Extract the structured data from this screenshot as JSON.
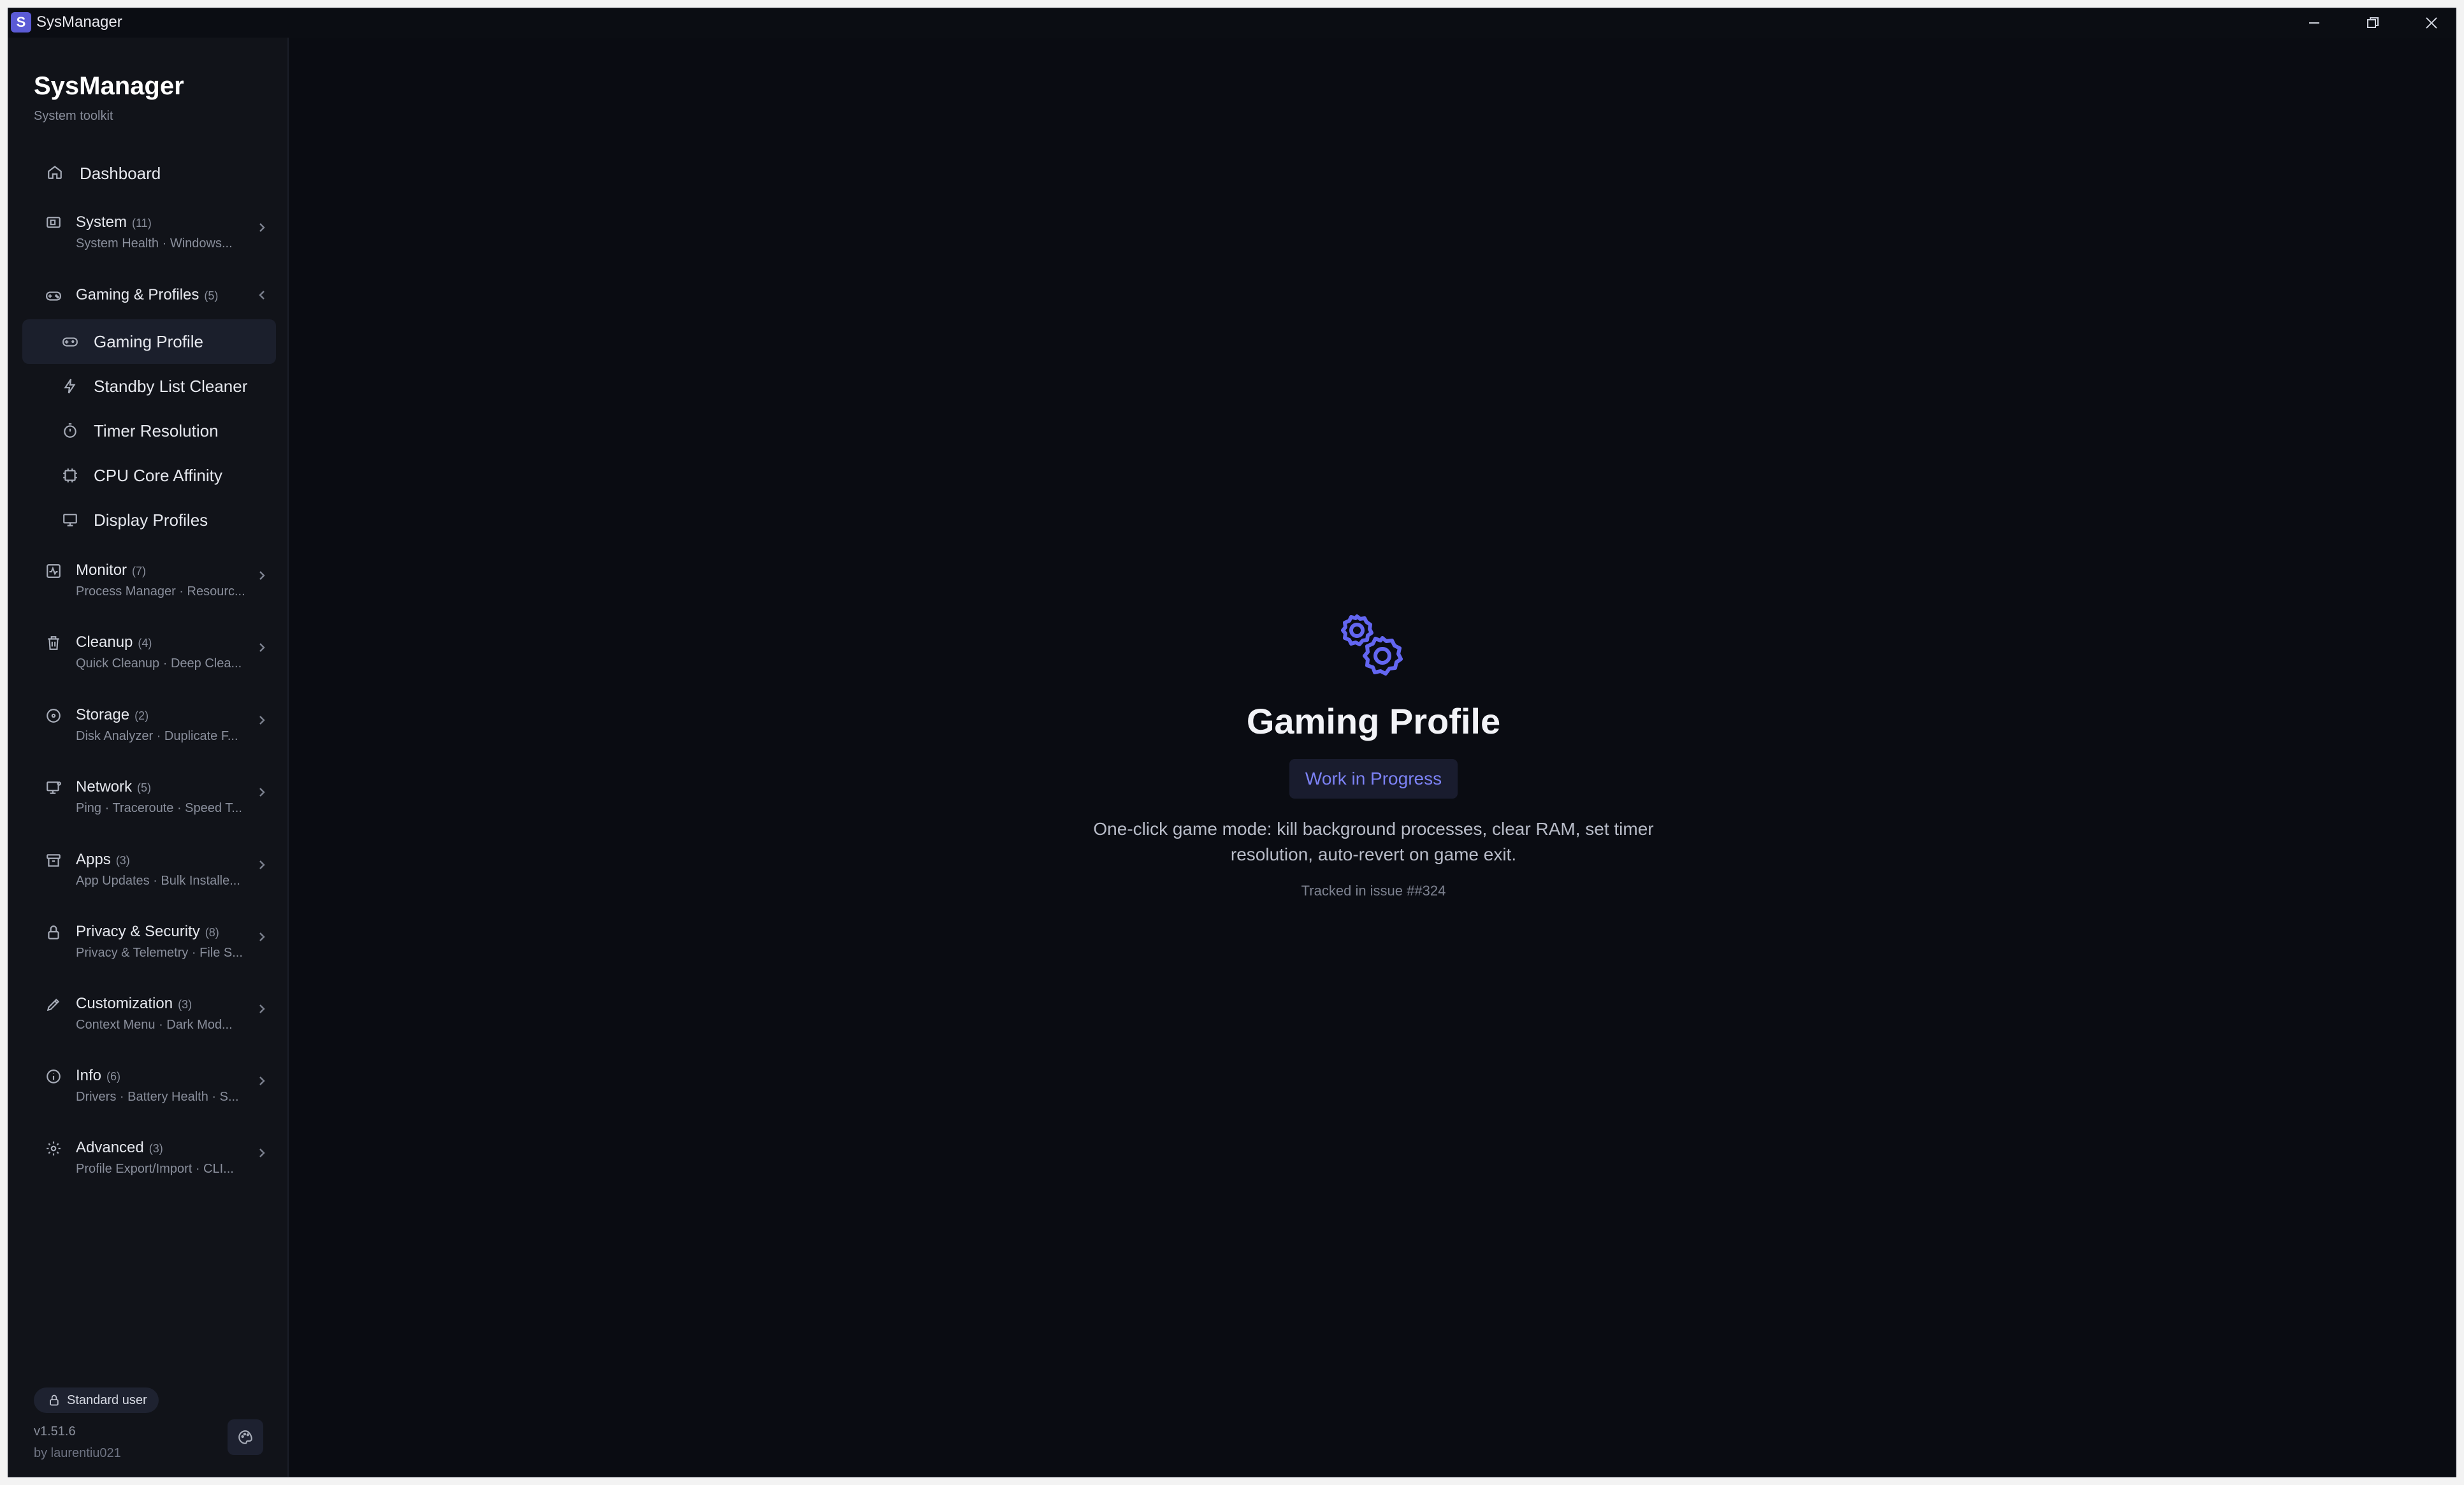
{
  "window": {
    "title": "SysManager",
    "badge_letter": "S"
  },
  "brand": {
    "title": "SysManager",
    "subtitle": "System toolkit"
  },
  "sidebar": {
    "dashboard": "Dashboard",
    "groups": [
      {
        "label": "System",
        "count": "(11)",
        "sub": "System Health · Windows..."
      },
      {
        "label": "Gaming & Profiles",
        "count": "(5)",
        "sub": ""
      },
      {
        "label": "Monitor",
        "count": "(7)",
        "sub": "Process Manager · Resourc..."
      },
      {
        "label": "Cleanup",
        "count": "(4)",
        "sub": "Quick Cleanup · Deep Clea..."
      },
      {
        "label": "Storage",
        "count": "(2)",
        "sub": "Disk Analyzer · Duplicate F..."
      },
      {
        "label": "Network",
        "count": "(5)",
        "sub": "Ping · Traceroute · Speed T..."
      },
      {
        "label": "Apps",
        "count": "(3)",
        "sub": "App Updates · Bulk Installe..."
      },
      {
        "label": "Privacy & Security",
        "count": "(8)",
        "sub": "Privacy & Telemetry · File S..."
      },
      {
        "label": "Customization",
        "count": "(3)",
        "sub": "Context Menu · Dark Mod..."
      },
      {
        "label": "Info",
        "count": "(6)",
        "sub": "Drivers · Battery Health · S..."
      },
      {
        "label": "Advanced",
        "count": "(3)",
        "sub": "Profile Export/Import · CLI..."
      }
    ],
    "gaming_items": [
      "Gaming Profile",
      "Standby List Cleaner",
      "Timer Resolution",
      "CPU Core Affinity",
      "Display Profiles"
    ],
    "user_role": "Standard user",
    "version": "v1.51.6",
    "author": "by laurentiu021"
  },
  "main": {
    "title": "Gaming Profile",
    "status": "Work in Progress",
    "description": "One-click game mode: kill background processes, clear RAM, set timer resolution, auto-revert on game exit.",
    "issue": "Tracked in issue ##324"
  },
  "colors": {
    "accent": "#5b5bd6",
    "accent_text": "#7c82f5",
    "background": "#0a0c12",
    "sidebar": "#111319"
  }
}
